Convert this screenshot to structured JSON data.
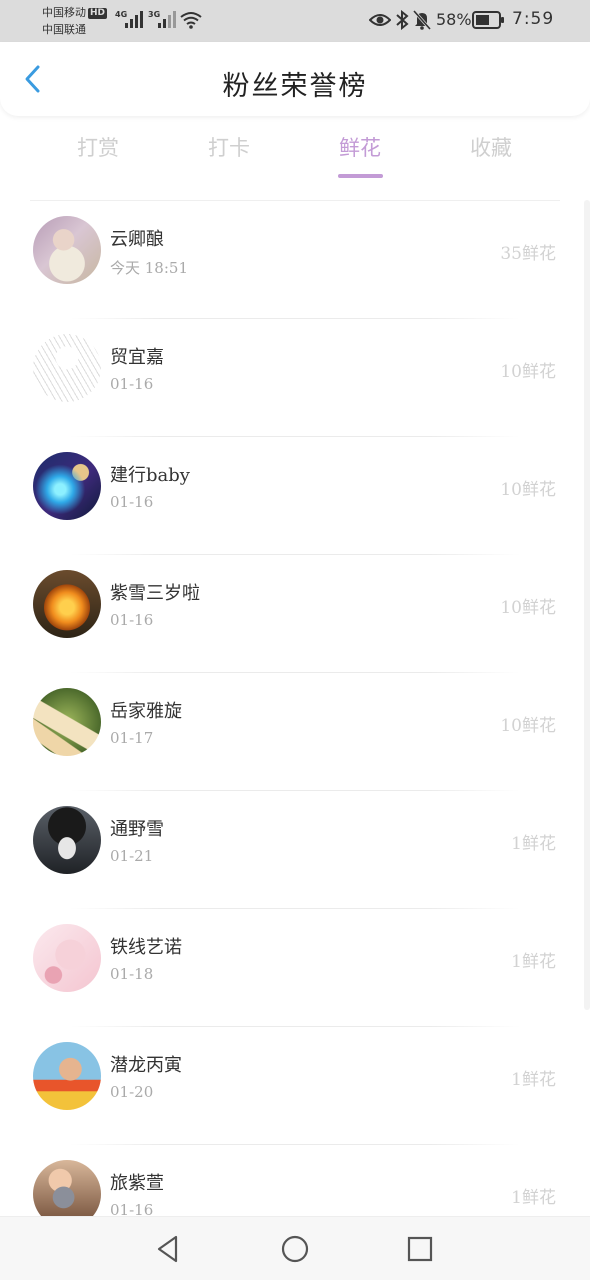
{
  "status_bar": {
    "carrier_primary": "中国移动",
    "carrier_badge": "HD",
    "carrier_secondary": "中国联通",
    "signal_1_label": "4G",
    "signal_2_label": "3G",
    "battery_percent": "58%",
    "time": "7:59"
  },
  "header": {
    "title": "粉丝荣誉榜"
  },
  "tabs": [
    {
      "label": "打赏",
      "active": false
    },
    {
      "label": "打卡",
      "active": false
    },
    {
      "label": "鲜花",
      "active": true
    },
    {
      "label": "收藏",
      "active": false
    }
  ],
  "colors": {
    "accent": "#c39bd6",
    "tab_inactive": "#cfcfcf",
    "back_icon": "#3a9be0",
    "amount_text": "#d2d2d2"
  },
  "fans": [
    {
      "name": "云卿酿",
      "date": "今天 18:51",
      "amount": "35鲜花",
      "avatar": "anime-girl-flowers"
    },
    {
      "name": "贸宜嘉",
      "date": "01-16",
      "amount": "10鲜花",
      "avatar": "sketch-figure"
    },
    {
      "name": "建行baby",
      "date": "01-16",
      "amount": "10鲜花",
      "avatar": "anime-blue-glow"
    },
    {
      "name": "紫雪三岁啦",
      "date": "01-16",
      "amount": "10鲜花",
      "avatar": "lantern-pumpkin"
    },
    {
      "name": "岳家雅旋",
      "date": "01-17",
      "amount": "10鲜花",
      "avatar": "spring-rolls-food"
    },
    {
      "name": "通野雪",
      "date": "01-21",
      "amount": "1鲜花",
      "avatar": "anime-boy-dark"
    },
    {
      "name": "铁线艺诺",
      "date": "01-18",
      "amount": "1鲜花",
      "avatar": "pink-cartoon"
    },
    {
      "name": "潜龙丙寅",
      "date": "01-20",
      "amount": "1鲜花",
      "avatar": "photo-child"
    },
    {
      "name": "旅紫萱",
      "date": "01-16",
      "amount": "1鲜花",
      "avatar": "girl-with-cat"
    }
  ],
  "nav_bar": {
    "icons": [
      "back-triangle-icon",
      "home-circle-icon",
      "recents-square-icon"
    ]
  }
}
